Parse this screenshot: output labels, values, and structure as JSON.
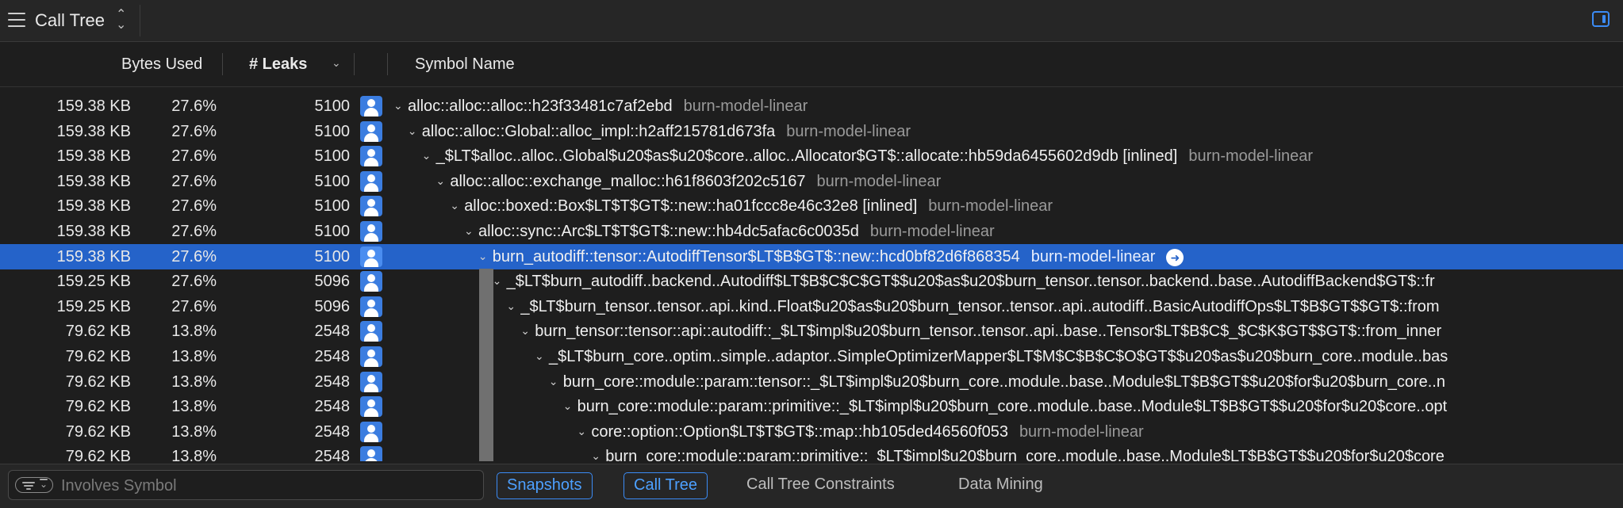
{
  "toolbar": {
    "title": "Call Tree",
    "menu_icon": "hamburger-icon",
    "updown_icon": "up-down-chevron-icon",
    "sidebar_icon": "sidebar-toggle-icon"
  },
  "columns": {
    "bytes_used": "Bytes Used",
    "leaks": "# Leaks",
    "symbol_name": "Symbol Name"
  },
  "rows": [
    {
      "bytes": "159.38 KB",
      "pct": "27.6%",
      "leaks": "5100",
      "indent": 0,
      "symbol": "alloc::alloc::alloc::h23f33481c7af2ebd",
      "library": "burn-model-linear"
    },
    {
      "bytes": "159.38 KB",
      "pct": "27.6%",
      "leaks": "5100",
      "indent": 1,
      "symbol": "alloc::alloc::Global::alloc_impl::h2aff215781d673fa",
      "library": "burn-model-linear"
    },
    {
      "bytes": "159.38 KB",
      "pct": "27.6%",
      "leaks": "5100",
      "indent": 2,
      "symbol": "_$LT$alloc..alloc..Global$u20$as$u20$core..alloc..Allocator$GT$::allocate::hb59da6455602d9db [inlined]",
      "library": "burn-model-linear"
    },
    {
      "bytes": "159.38 KB",
      "pct": "27.6%",
      "leaks": "5100",
      "indent": 3,
      "symbol": "alloc::alloc::exchange_malloc::h61f8603f202c5167",
      "library": "burn-model-linear"
    },
    {
      "bytes": "159.38 KB",
      "pct": "27.6%",
      "leaks": "5100",
      "indent": 4,
      "symbol": "alloc::boxed::Box$LT$T$GT$::new::ha01fccc8e46c32e8 [inlined]",
      "library": "burn-model-linear"
    },
    {
      "bytes": "159.38 KB",
      "pct": "27.6%",
      "leaks": "5100",
      "indent": 5,
      "symbol": "alloc::sync::Arc$LT$T$GT$::new::hb4dc5afac6c0035d",
      "library": "burn-model-linear"
    },
    {
      "bytes": "159.38 KB",
      "pct": "27.6%",
      "leaks": "5100",
      "indent": 6,
      "symbol": "burn_autodiff::tensor::AutodiffTensor$LT$B$GT$::new::hcd0bf82d6f868354",
      "library": "burn-model-linear",
      "selected": true
    },
    {
      "bytes": "159.25 KB",
      "pct": "27.6%",
      "leaks": "5096",
      "indent": 7,
      "symbol": "_$LT$burn_autodiff..backend..Autodiff$LT$B$C$C$GT$$u20$as$u20$burn_tensor..tensor..backend..base..AutodiffBackend$GT$::fr",
      "library": ""
    },
    {
      "bytes": "159.25 KB",
      "pct": "27.6%",
      "leaks": "5096",
      "indent": 8,
      "symbol": "_$LT$burn_tensor..tensor..api..kind..Float$u20$as$u20$burn_tensor..tensor..api..autodiff..BasicAutodiffOps$LT$B$GT$$GT$::from",
      "library": ""
    },
    {
      "bytes": "79.62 KB",
      "pct": "13.8%",
      "leaks": "2548",
      "indent": 9,
      "symbol": "burn_tensor::tensor::api::autodiff::_$LT$impl$u20$burn_tensor..tensor..api..base..Tensor$LT$B$C$_$C$K$GT$$GT$::from_inner",
      "library": ""
    },
    {
      "bytes": "79.62 KB",
      "pct": "13.8%",
      "leaks": "2548",
      "indent": 10,
      "symbol": "_$LT$burn_core..optim..simple..adaptor..SimpleOptimizerMapper$LT$M$C$B$C$O$GT$$u20$as$u20$burn_core..module..bas",
      "library": ""
    },
    {
      "bytes": "79.62 KB",
      "pct": "13.8%",
      "leaks": "2548",
      "indent": 11,
      "symbol": "burn_core::module::param::tensor::_$LT$impl$u20$burn_core..module..base..Module$LT$B$GT$$u20$for$u20$burn_core..n",
      "library": ""
    },
    {
      "bytes": "79.62 KB",
      "pct": "13.8%",
      "leaks": "2548",
      "indent": 12,
      "symbol": "burn_core::module::param::primitive::_$LT$impl$u20$burn_core..module..base..Module$LT$B$GT$$u20$for$u20$core..opt",
      "library": ""
    },
    {
      "bytes": "79.62 KB",
      "pct": "13.8%",
      "leaks": "2548",
      "indent": 13,
      "symbol": "core::option::Option$LT$T$GT$::map::hb105ded46560f053",
      "library": "burn-model-linear"
    },
    {
      "bytes": "79.62 KB",
      "pct": "13.8%",
      "leaks": "2548",
      "indent": 14,
      "symbol": "burn_core::module::param::primitive::_$LT$impl$u20$burn_core..module..base..Module$LT$B$GT$$u20$for$u20$core",
      "library": ""
    }
  ],
  "bottom": {
    "search_placeholder": "Involves Symbol",
    "filter_icon": "filter-icon",
    "tabs": [
      {
        "label": "Snapshots",
        "active": true
      },
      {
        "label": "Call Tree",
        "active": true
      },
      {
        "label": "Call Tree Constraints",
        "active": false
      },
      {
        "label": "Data Mining",
        "active": false
      }
    ]
  },
  "colors": {
    "selection": "#2563c9",
    "accent": "#3b8bf5",
    "background": "#1e1e1e"
  }
}
